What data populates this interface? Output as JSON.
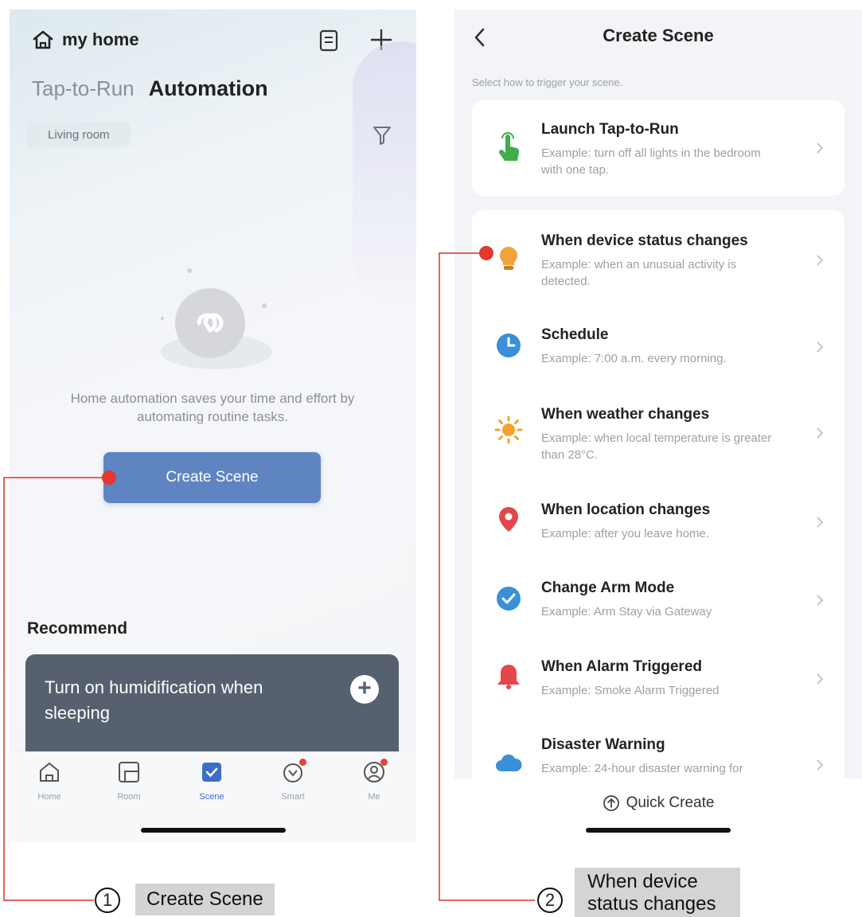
{
  "left_screen": {
    "home_name": "my home",
    "tabs": {
      "tap_to_run": "Tap-to-Run",
      "automation": "Automation"
    },
    "room_filter": "Living room",
    "empty_message": "Home automation saves your time and effort by automating routine tasks.",
    "create_button": "Create Scene",
    "recommend_title": "Recommend",
    "recommend_card": "Turn on humidification when sleeping",
    "tabbar": [
      {
        "label": "Home",
        "icon": "home-icon"
      },
      {
        "label": "Room",
        "icon": "room-icon"
      },
      {
        "label": "Scene",
        "icon": "scene-icon",
        "active": true
      },
      {
        "label": "Smart",
        "icon": "smart-icon"
      },
      {
        "label": "Me",
        "icon": "profile-icon"
      }
    ]
  },
  "right_screen": {
    "title": "Create Scene",
    "subtitle": "Select how to trigger your scene.",
    "tap_to_run": {
      "title": "Launch Tap-to-Run",
      "desc": "Example: turn off all lights in the bedroom with one tap."
    },
    "options": [
      {
        "title": "When device status changes",
        "desc": "Example: when an unusual activity is detected.",
        "icon": "bulb-icon",
        "color": "#f0a33a"
      },
      {
        "title": "Schedule",
        "desc": "Example: 7:00 a.m. every morning.",
        "icon": "clock-icon",
        "color": "#3b8fd8"
      },
      {
        "title": "When weather changes",
        "desc": "Example: when local temperature is greater than 28°C.",
        "icon": "sun-icon",
        "color": "#f2a32a"
      },
      {
        "title": "When location changes",
        "desc": "Example: after you leave home.",
        "icon": "location-pin-icon",
        "color": "#e5464b"
      },
      {
        "title": "Change Arm Mode",
        "desc": "Example: Arm Stay via Gateway",
        "icon": "shield-check-icon",
        "color": "#3b8fd8"
      },
      {
        "title": "When Alarm Triggered",
        "desc": "Example: Smoke Alarm Triggered",
        "icon": "alarm-bell-icon",
        "color": "#e5464b"
      },
      {
        "title": "Disaster Warning",
        "desc": "Example: 24-hour disaster warning for",
        "icon": "cloud-icon",
        "color": "#3b8fd8"
      }
    ],
    "quick_create": "Quick Create"
  },
  "annotations": [
    {
      "number": "1",
      "label": "Create Scene"
    },
    {
      "number": "2",
      "label": "When device status changes"
    }
  ],
  "colors": {
    "accent": "#5e84c2",
    "callout_line": "#d9342b",
    "annotation_bg": "#d4d4d4"
  }
}
